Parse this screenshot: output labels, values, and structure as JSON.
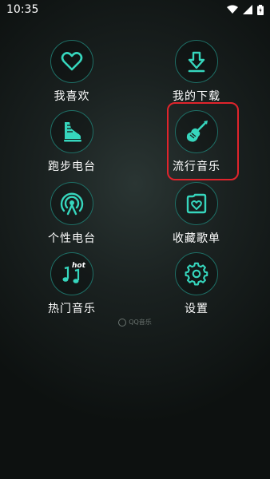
{
  "status_bar": {
    "time": "10:35"
  },
  "menu": {
    "favorites": "我喜欢",
    "downloads": "我的下载",
    "running_radio": "跑步电台",
    "popular_music": "流行音乐",
    "personal_radio": "个性电台",
    "saved_playlists": "收藏歌单",
    "hot_music": "热门音乐",
    "settings": "设置"
  },
  "icons": {
    "favorites": "heart-icon",
    "downloads": "download-icon",
    "running_radio": "running-shoe-icon",
    "popular_music": "electric-guitar-icon",
    "personal_radio": "radio-signal-icon",
    "saved_playlists": "heart-folder-icon",
    "hot_music": "hot-music-note-icon",
    "settings": "gear-icon"
  },
  "hot_badge": "hot",
  "brand": "QQ音乐",
  "colors": {
    "accent": "#36d6bd",
    "ring": "#1e6f66",
    "highlight": "#e0242c"
  }
}
